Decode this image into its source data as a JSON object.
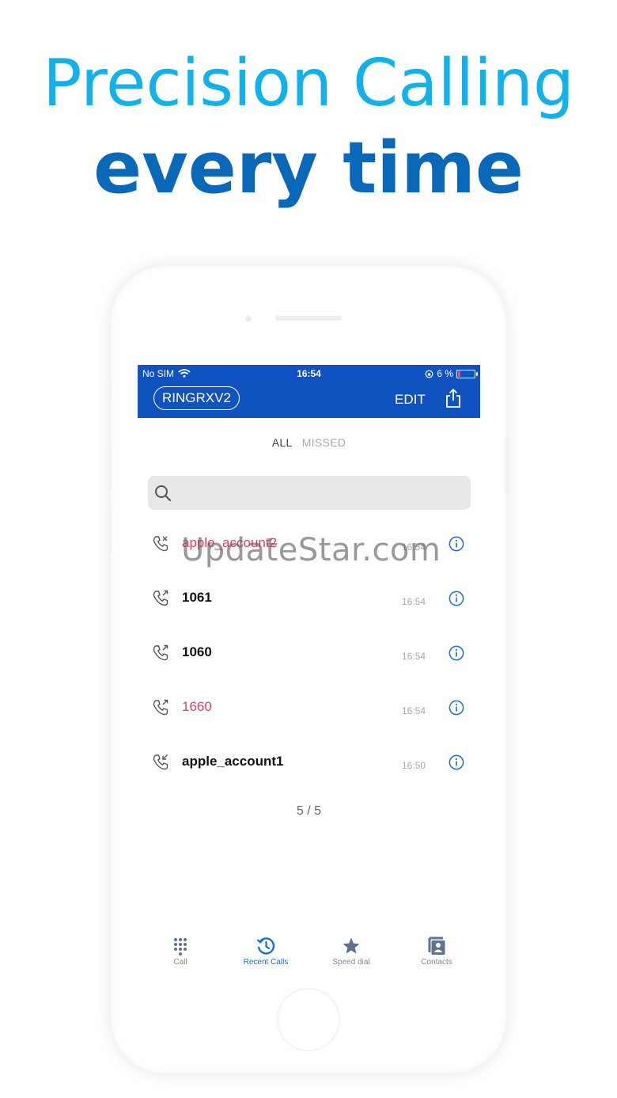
{
  "headline": {
    "line1": "Precision Calling",
    "line2": "every time"
  },
  "status_bar": {
    "carrier": "No SIM",
    "time": "16:54",
    "battery": "6 %"
  },
  "top_bar": {
    "account": "RINGRXV2",
    "edit_label": "EDIT"
  },
  "filters": {
    "all": "ALL",
    "missed": "MISSED"
  },
  "search": {
    "placeholder": ""
  },
  "calls": [
    {
      "name": "apple_account2",
      "time": "16:54",
      "type": "missed",
      "missed": true
    },
    {
      "name": "1061",
      "time": "16:54",
      "type": "outgoing",
      "missed": false
    },
    {
      "name": "1060",
      "time": "16:54",
      "type": "outgoing",
      "missed": false
    },
    {
      "name": "1660",
      "time": "16:54",
      "type": "outgoing",
      "missed": true
    },
    {
      "name": "apple_account1",
      "time": "16:50",
      "type": "incoming",
      "missed": false
    }
  ],
  "counter": "5 / 5",
  "nav": [
    {
      "label": "Call",
      "icon": "dialpad-icon",
      "active": false
    },
    {
      "label": "Recent Calls",
      "icon": "history-icon",
      "active": true
    },
    {
      "label": "Speed dial",
      "icon": "star-icon",
      "active": false
    },
    {
      "label": "Contacts",
      "icon": "contacts-icon",
      "active": false
    }
  ],
  "watermark": "UpdateStar.com",
  "colors": {
    "accent": "#1152c1",
    "headline_light": "#12b2e8",
    "headline_dark": "#0a68b8",
    "missed": "#e0405e",
    "active_nav": "#1a6fd0"
  }
}
